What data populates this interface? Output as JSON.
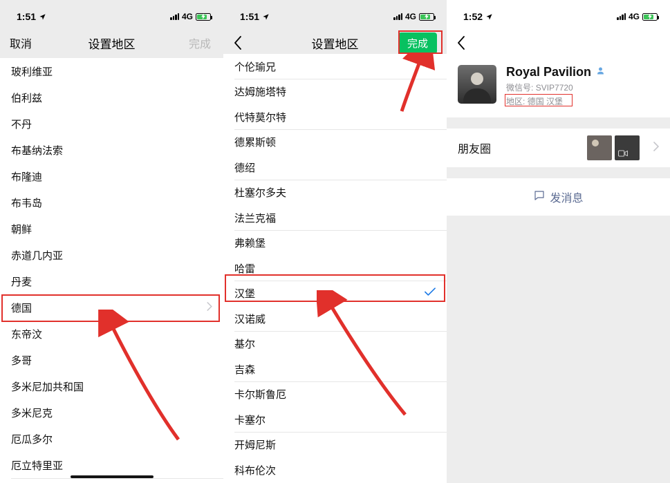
{
  "status": {
    "time1": "1:51",
    "time2": "1:51",
    "time3": "1:52",
    "net": "4G"
  },
  "screen1": {
    "nav": {
      "cancel": "取消",
      "title": "设置地区",
      "done": "完成"
    },
    "rowHighlightIndex": 9,
    "countries": [
      "玻利维亚",
      "伯利兹",
      "不丹",
      "布基纳法索",
      "布隆迪",
      "布韦岛",
      "朝鲜",
      "赤道几内亚",
      "丹麦",
      "德国",
      "东帝汶",
      "多哥",
      "多米尼加共和国",
      "多米尼克",
      "厄瓜多尔",
      "厄立特里亚"
    ]
  },
  "screen2": {
    "nav": {
      "title": "设置地区",
      "done": "完成"
    },
    "selectedIndex": 9,
    "cities": [
      "个伦瑜兄",
      "达姆施塔特",
      "代特莫尔特",
      "德累斯顿",
      "德绍",
      "杜塞尔多夫",
      "法兰克福",
      "弗赖堡",
      "哈雷",
      "汉堡",
      "汉诺威",
      "基尔",
      "吉森",
      "卡尔斯鲁厄",
      "卡塞尔",
      "开姆尼斯",
      "科布伦次"
    ]
  },
  "screen3": {
    "profile": {
      "name": "Royal Pavilion",
      "wechat_label": "微信号:",
      "wechat_id": "SVIP7720",
      "region_label": "地区:",
      "region_value": "德国 汉堡"
    },
    "moments": {
      "label": "朋友圈"
    },
    "action": {
      "label": "发消息"
    }
  }
}
